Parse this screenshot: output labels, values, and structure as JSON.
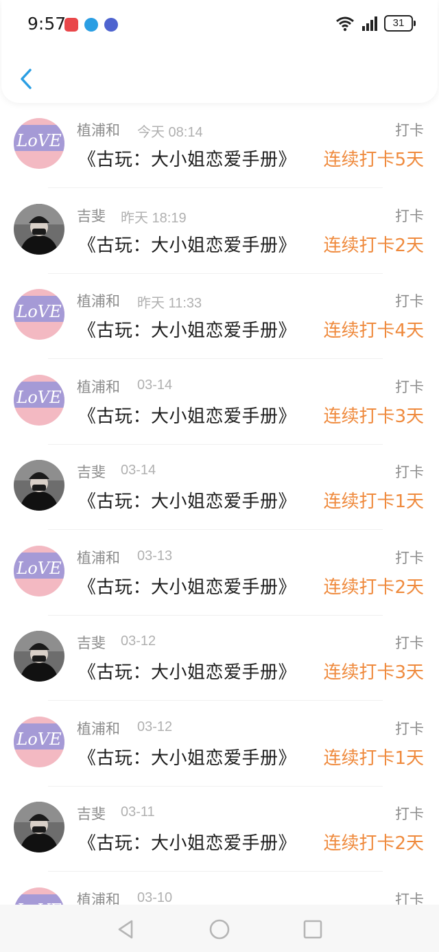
{
  "status_bar": {
    "time": "9:57",
    "notification_icons": [
      "app-red-icon",
      "app-blue-icon",
      "music-icon"
    ],
    "battery": "31"
  },
  "nav": {
    "back_icon": "chevron-left-icon",
    "accent_color": "#2a9ee3"
  },
  "colors": {
    "streak": "#ef8a3d",
    "author": "#8c8c8c",
    "date": "#b0b0b0",
    "title": "#1c1c1c"
  },
  "checkins": [
    {
      "avatar": "love-avatar",
      "author": "植浦和",
      "date": "今天 08:14",
      "badge": "打卡",
      "book": "《古玩：大小姐恋爱手册》",
      "streak": "连续打卡5天"
    },
    {
      "avatar": "masked-avatar",
      "author": "吉斐",
      "date": "昨天 18:19",
      "badge": "打卡",
      "book": "《古玩：大小姐恋爱手册》",
      "streak": "连续打卡2天"
    },
    {
      "avatar": "love-avatar",
      "author": "植浦和",
      "date": "昨天 11:33",
      "badge": "打卡",
      "book": "《古玩：大小姐恋爱手册》",
      "streak": "连续打卡4天"
    },
    {
      "avatar": "love-avatar",
      "author": "植浦和",
      "date": "03-14",
      "badge": "打卡",
      "book": "《古玩：大小姐恋爱手册》",
      "streak": "连续打卡3天"
    },
    {
      "avatar": "masked-avatar",
      "author": "吉斐",
      "date": "03-14",
      "badge": "打卡",
      "book": "《古玩：大小姐恋爱手册》",
      "streak": "连续打卡1天"
    },
    {
      "avatar": "love-avatar",
      "author": "植浦和",
      "date": "03-13",
      "badge": "打卡",
      "book": "《古玩：大小姐恋爱手册》",
      "streak": "连续打卡2天"
    },
    {
      "avatar": "masked-avatar",
      "author": "吉斐",
      "date": "03-12",
      "badge": "打卡",
      "book": "《古玩：大小姐恋爱手册》",
      "streak": "连续打卡3天"
    },
    {
      "avatar": "love-avatar",
      "author": "植浦和",
      "date": "03-12",
      "badge": "打卡",
      "book": "《古玩：大小姐恋爱手册》",
      "streak": "连续打卡1天"
    },
    {
      "avatar": "masked-avatar",
      "author": "吉斐",
      "date": "03-11",
      "badge": "打卡",
      "book": "《古玩：大小姐恋爱手册》",
      "streak": "连续打卡2天"
    },
    {
      "avatar": "love-avatar",
      "author": "植浦和",
      "date": "03-10",
      "badge": "打卡",
      "book": "",
      "streak": ""
    }
  ],
  "system_nav": [
    "back-triangle-icon",
    "home-circle-icon",
    "recents-square-icon"
  ]
}
